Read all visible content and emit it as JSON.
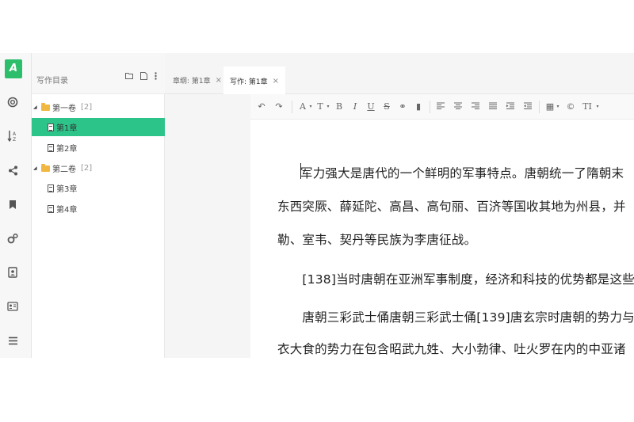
{
  "logo": {
    "letter": "A"
  },
  "rail_icons": [
    "lifebuoy-icon",
    "sort-az-icon",
    "share-icon",
    "bookmark-icon",
    "settings-icon",
    "contact-icon",
    "id-card-icon",
    "menu-icon"
  ],
  "directory": {
    "title": "写作目录",
    "volumes": [
      {
        "label": "第一卷",
        "count": "[2]",
        "chapters": [
          "第1章",
          "第2章"
        ]
      },
      {
        "label": "第二卷",
        "count": "[2]",
        "chapters": [
          "第3章",
          "第4章"
        ]
      }
    ],
    "active_chapter": "第1章"
  },
  "tabs": [
    {
      "label": "章纲: 第1章",
      "close": "×",
      "active": false
    },
    {
      "label": "写作: 第1章",
      "close": "×",
      "active": true
    }
  ],
  "toolbar": {
    "undo": "↶",
    "redo": "↷",
    "font_color": "A",
    "font_size": "T",
    "bold": "B",
    "italic": "I",
    "underline": "U",
    "strikethrough": "S",
    "link": "⚭",
    "bookmark": "▮",
    "table": "▦",
    "copyright": "©",
    "text_format": "TI"
  },
  "editor": {
    "paragraphs": [
      "军力强大是唐代的一个鲜明的军事特点。唐朝统一了隋朝末",
      "东西突厥、薛延陀、高昌、高句丽、百济等国收其地为州县，并",
      "勒、室韦、契丹等民族为李唐征战。",
      "　　[138]当时唐朝在亚洲军事制度，经济和科技的优势都是这些",
      "　　唐朝三彩武士俑唐朝三彩武士俑[139]唐玄宗时唐朝的势力与",
      "衣大食的势力在包含昭武九姓、大小勃律、吐火罗在内的中亚诸"
    ]
  }
}
